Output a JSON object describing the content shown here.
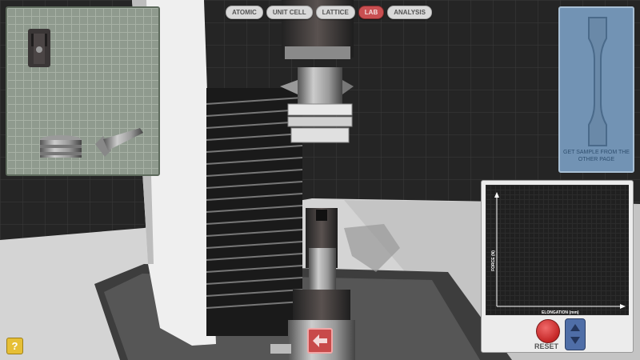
{
  "nav": {
    "tabs": [
      {
        "label": "ATOMIC",
        "active": false
      },
      {
        "label": "UNIT CELL",
        "active": false
      },
      {
        "label": "LATTICE",
        "active": false
      },
      {
        "label": "LAB",
        "active": true
      },
      {
        "label": "ANALYSIS",
        "active": false
      }
    ]
  },
  "sample_panel": {
    "instruction": "GET SAMPLE FROM THE OTHER PAGE"
  },
  "graph": {
    "ylabel": "FORCE (N)",
    "xlabel": "ELONGATION (mm)",
    "reset_label": "RESET"
  },
  "help": {
    "label": "?"
  },
  "icons": {
    "back": "arrow-left-icon",
    "stepper": "up-down-stepper-icon",
    "help": "question-mark-icon"
  },
  "colors": {
    "active_tab": "#c94f51",
    "reset": "#c42626",
    "stepper": "#4f6ea7",
    "sample_panel": "#7293b4",
    "help": "#e6bf36"
  }
}
